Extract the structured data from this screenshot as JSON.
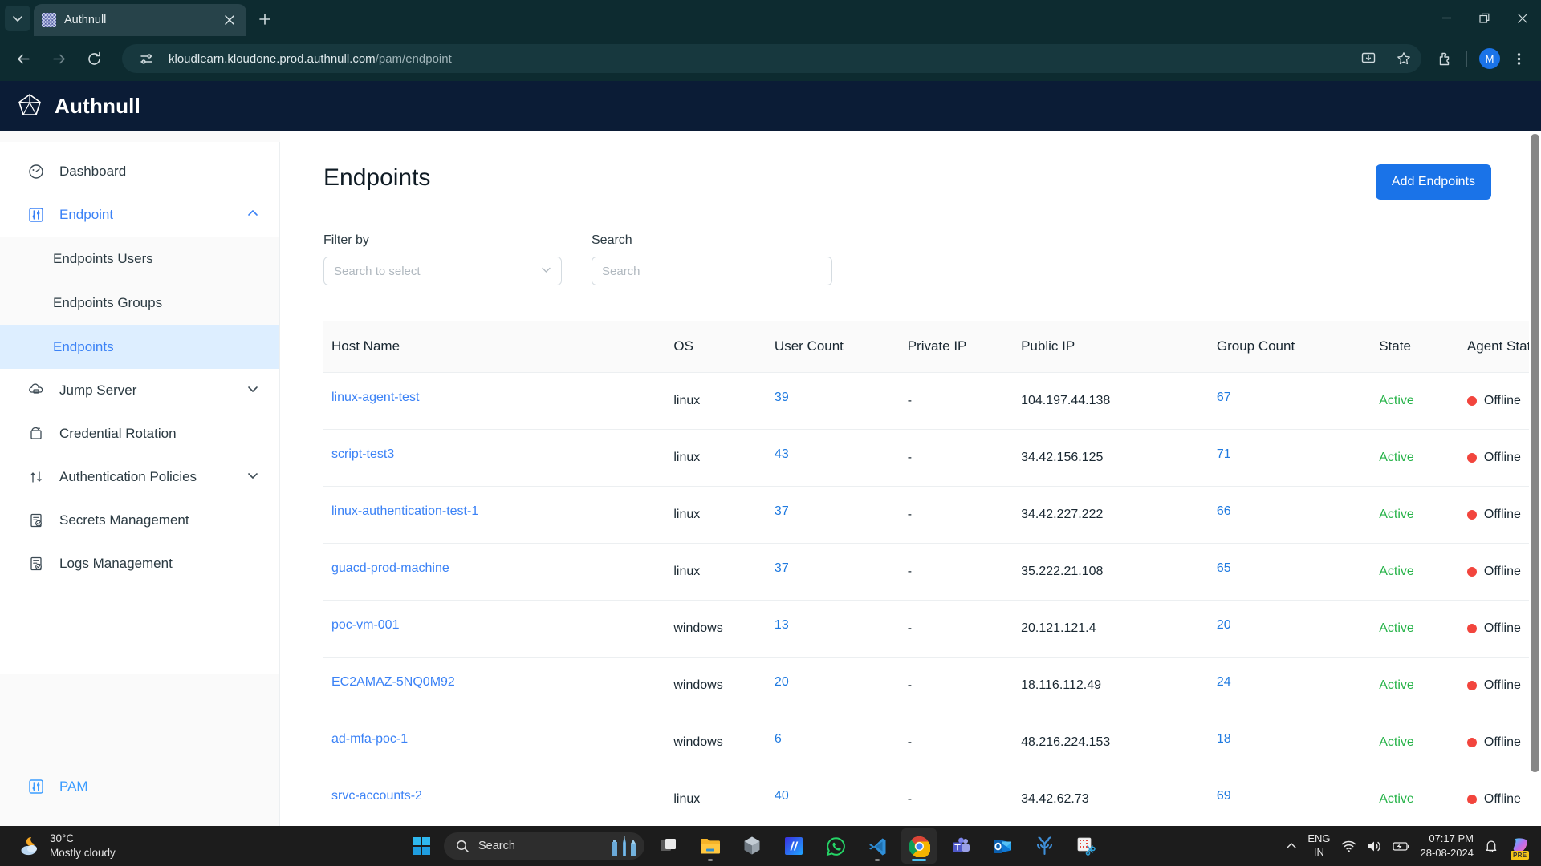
{
  "browser": {
    "tab": {
      "title": "Authnull",
      "favicon_icon": "authnull-favicon"
    },
    "new_tab_label": "+",
    "url_host": "kloudlearn.kloudone.prod.authnull.com",
    "url_path": "/pam/endpoint",
    "profile_initial": "M",
    "icons": {
      "tab_list": "chevron-down-icon",
      "close_tab": "close-icon",
      "back": "back-arrow-icon",
      "forward": "forward-arrow-icon",
      "reload": "reload-icon",
      "site_info": "site-settings-icon",
      "install": "install-app-icon",
      "bookmark": "star-icon",
      "extensions": "extensions-puzzle-icon",
      "menu": "three-dot-menu-icon",
      "minimize": "minimize-icon",
      "maximize": "restore-window-icon",
      "close_window": "close-window-icon"
    }
  },
  "app": {
    "brand": "Authnull",
    "brand_icon": "authnull-logo-icon"
  },
  "sidebar": {
    "items": [
      {
        "label": "Dashboard",
        "icon": "dashboard-gauge-icon",
        "active": false,
        "expandable": false
      },
      {
        "label": "Endpoint",
        "icon": "sliders-icon",
        "active": true,
        "expandable": true,
        "expanded": true
      },
      {
        "label": "Jump Server",
        "icon": "server-cloud-icon",
        "active": false,
        "expandable": true,
        "expanded": false
      },
      {
        "label": "Credential Rotation",
        "icon": "rotate-icon",
        "active": false,
        "expandable": false
      },
      {
        "label": "Authentication Policies",
        "icon": "policy-flow-icon",
        "active": false,
        "expandable": true,
        "expanded": false
      },
      {
        "label": "Secrets Management",
        "icon": "secrets-shield-doc-icon",
        "active": false,
        "expandable": false
      },
      {
        "label": "Logs Management",
        "icon": "logs-shield-doc-icon",
        "active": false,
        "expandable": false
      }
    ],
    "endpoint_children": [
      {
        "label": "Endpoints Users",
        "selected": false
      },
      {
        "label": "Endpoints Groups",
        "selected": false
      },
      {
        "label": "Endpoints",
        "selected": true
      }
    ],
    "footer": {
      "label": "PAM",
      "icon": "sliders-icon"
    },
    "accent_color": "#3b82f6",
    "selected_bg": "#ddeeff"
  },
  "main": {
    "title": "Endpoints",
    "add_button": "Add Endpoints",
    "filter": {
      "label": "Filter by",
      "placeholder": "Search to select",
      "value": "",
      "chevron_icon": "chevron-down-icon"
    },
    "search": {
      "label": "Search",
      "placeholder": "Search",
      "value": ""
    },
    "table": {
      "columns": [
        "Host Name",
        "OS",
        "User Count",
        "Private IP",
        "Public IP",
        "Group Count",
        "State",
        "Agent Status"
      ],
      "agent_column_clipped_label": "Agent S",
      "rows": [
        {
          "host": "linux-agent-test",
          "os": "linux",
          "users": "39",
          "private_ip": "-",
          "public_ip": "104.197.44.138",
          "groups": "67",
          "state": "Active",
          "agent_status": "Offline"
        },
        {
          "host": "script-test3",
          "os": "linux",
          "users": "43",
          "private_ip": "-",
          "public_ip": "34.42.156.125",
          "groups": "71",
          "state": "Active",
          "agent_status": "Offline"
        },
        {
          "host": "linux-authentication-test-1",
          "os": "linux",
          "users": "37",
          "private_ip": "-",
          "public_ip": "34.42.227.222",
          "groups": "66",
          "state": "Active",
          "agent_status": "Offline"
        },
        {
          "host": "guacd-prod-machine",
          "os": "linux",
          "users": "37",
          "private_ip": "-",
          "public_ip": "35.222.21.108",
          "groups": "65",
          "state": "Active",
          "agent_status": "Offline"
        },
        {
          "host": "poc-vm-001",
          "os": "windows",
          "users": "13",
          "private_ip": "-",
          "public_ip": "20.121.121.4",
          "groups": "20",
          "state": "Active",
          "agent_status": "Offline"
        },
        {
          "host": "EC2AMAZ-5NQ0M92",
          "os": "windows",
          "users": "20",
          "private_ip": "-",
          "public_ip": "18.116.112.49",
          "groups": "24",
          "state": "Active",
          "agent_status": "Offline"
        },
        {
          "host": "ad-mfa-poc-1",
          "os": "windows",
          "users": "6",
          "private_ip": "-",
          "public_ip": "48.216.224.153",
          "groups": "18",
          "state": "Active",
          "agent_status": "Offline"
        },
        {
          "host": "srvc-accounts-2",
          "os": "linux",
          "users": "40",
          "private_ip": "-",
          "public_ip": "34.42.62.73",
          "groups": "69",
          "state": "Active",
          "agent_status": "Offline"
        }
      ]
    },
    "colors": {
      "primary": "#1a73e8",
      "link": "#3b82f6",
      "state_active": "#27b349",
      "offline_dot": "#f2453d"
    }
  },
  "taskbar": {
    "weather": {
      "temperature": "30°C",
      "condition": "Mostly cloudy",
      "icon": "moon-cloud-icon"
    },
    "start_icon": "windows-start-icon",
    "search": {
      "placeholder": "Search",
      "icon": "search-icon",
      "illustration_icon": "landmarks-icon"
    },
    "apps": [
      {
        "name": "task-view",
        "icon": "task-view-icon",
        "running": false,
        "active": false
      },
      {
        "name": "file-explorer",
        "icon": "file-explorer-icon",
        "running": true,
        "active": false
      },
      {
        "name": "hex-app",
        "icon": "hexagon-icon",
        "running": false,
        "active": false
      },
      {
        "name": "blue-m-app",
        "icon": "blue-m-app-icon",
        "running": false,
        "active": false
      },
      {
        "name": "whatsapp",
        "icon": "whatsapp-icon",
        "running": false,
        "active": false
      },
      {
        "name": "vs-code",
        "icon": "vscode-icon",
        "running": true,
        "active": false
      },
      {
        "name": "google-chrome",
        "icon": "chrome-icon",
        "running": true,
        "active": true
      },
      {
        "name": "microsoft-teams",
        "icon": "teams-icon",
        "running": false,
        "active": false
      },
      {
        "name": "microsoft-outlook",
        "icon": "outlook-icon",
        "running": false,
        "active": false
      },
      {
        "name": "coral-app",
        "icon": "coral-icon",
        "running": false,
        "active": false
      },
      {
        "name": "snipping-tool",
        "icon": "snipping-tool-icon",
        "running": false,
        "active": false
      }
    ],
    "tray": {
      "overflow_icon": "chevron-up-icon",
      "language_line1": "ENG",
      "language_line2": "IN",
      "wifi_icon": "wifi-icon",
      "volume_icon": "volume-icon",
      "battery_icon": "battery-charging-icon",
      "time": "07:17 PM",
      "date": "28-08-2024",
      "notifications_icon": "bell-icon",
      "copilot_icon": "copilot-icon",
      "copilot_badge": "PRE"
    }
  }
}
